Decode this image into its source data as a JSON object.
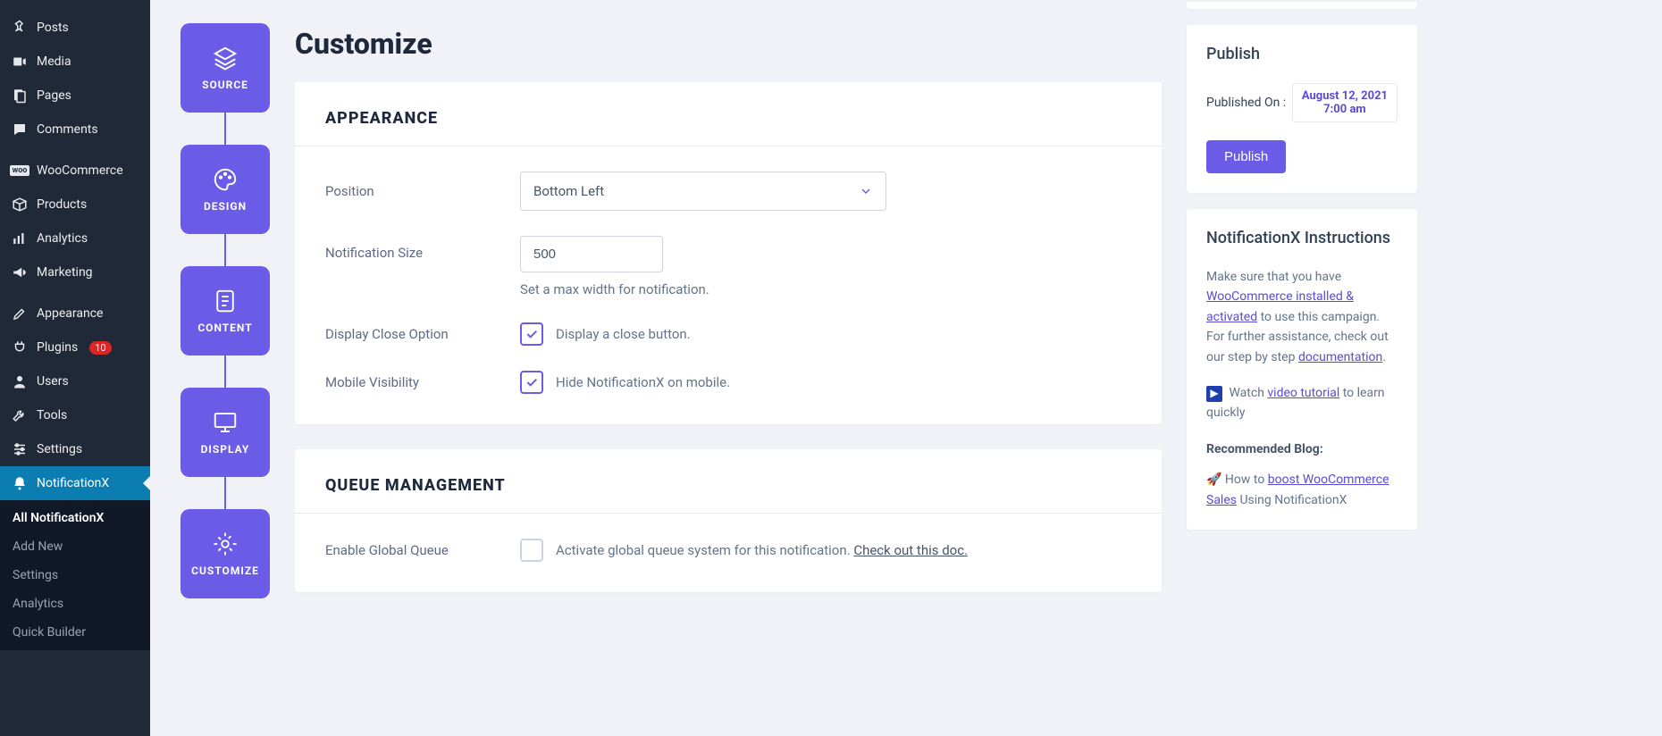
{
  "sidebar": {
    "items": [
      {
        "label": "Posts"
      },
      {
        "label": "Media"
      },
      {
        "label": "Pages"
      },
      {
        "label": "Comments"
      },
      {
        "label": "WooCommerce"
      },
      {
        "label": "Products"
      },
      {
        "label": "Analytics"
      },
      {
        "label": "Marketing"
      },
      {
        "label": "Appearance"
      },
      {
        "label": "Plugins",
        "badge": "10"
      },
      {
        "label": "Users"
      },
      {
        "label": "Tools"
      },
      {
        "label": "Settings"
      },
      {
        "label": "NotificationX"
      }
    ],
    "sub": [
      {
        "label": "All NotificationX"
      },
      {
        "label": "Add New"
      },
      {
        "label": "Settings"
      },
      {
        "label": "Analytics"
      },
      {
        "label": "Quick Builder"
      }
    ]
  },
  "steps": [
    {
      "label": "SOURCE"
    },
    {
      "label": "DESIGN"
    },
    {
      "label": "CONTENT"
    },
    {
      "label": "DISPLAY"
    },
    {
      "label": "CUSTOMIZE"
    }
  ],
  "page": {
    "title": "Customize"
  },
  "appearance": {
    "heading": "APPEARANCE",
    "position": {
      "label": "Position",
      "value": "Bottom Left"
    },
    "size": {
      "label": "Notification Size",
      "value": "500",
      "help": "Set a max width for notification."
    },
    "close": {
      "label": "Display Close Option",
      "text": "Display a close button.",
      "checked": true
    },
    "mobile": {
      "label": "Mobile Visibility",
      "text": "Hide NotificationX on mobile.",
      "checked": true
    }
  },
  "queue": {
    "heading": "QUEUE MANAGEMENT",
    "enable": {
      "label": "Enable Global Queue",
      "text": "Activate global queue system for this notification. ",
      "link": "Check out this doc.",
      "checked": false
    }
  },
  "publish": {
    "title": "Publish",
    "published_on": "Published On :",
    "date_line1": "August 12, 2021",
    "date_line2": "7:00 am",
    "button": "Publish"
  },
  "instructions": {
    "title": "NotificationX Instructions",
    "p1_a": "Make sure that you have ",
    "p1_link": "WooCommerce installed & activated",
    "p1_b": " to use this campaign. For further assistance, check out our step by step ",
    "p1_doc": "documentation",
    "p1_c": ".",
    "p2_a": "Watch ",
    "p2_link": "video tutorial",
    "p2_b": " to learn quickly",
    "blog_heading": "Recommended Blog:",
    "blog_a": "How to ",
    "blog_link": "boost WooCommerce Sales",
    "blog_b": " Using NotificationX"
  }
}
